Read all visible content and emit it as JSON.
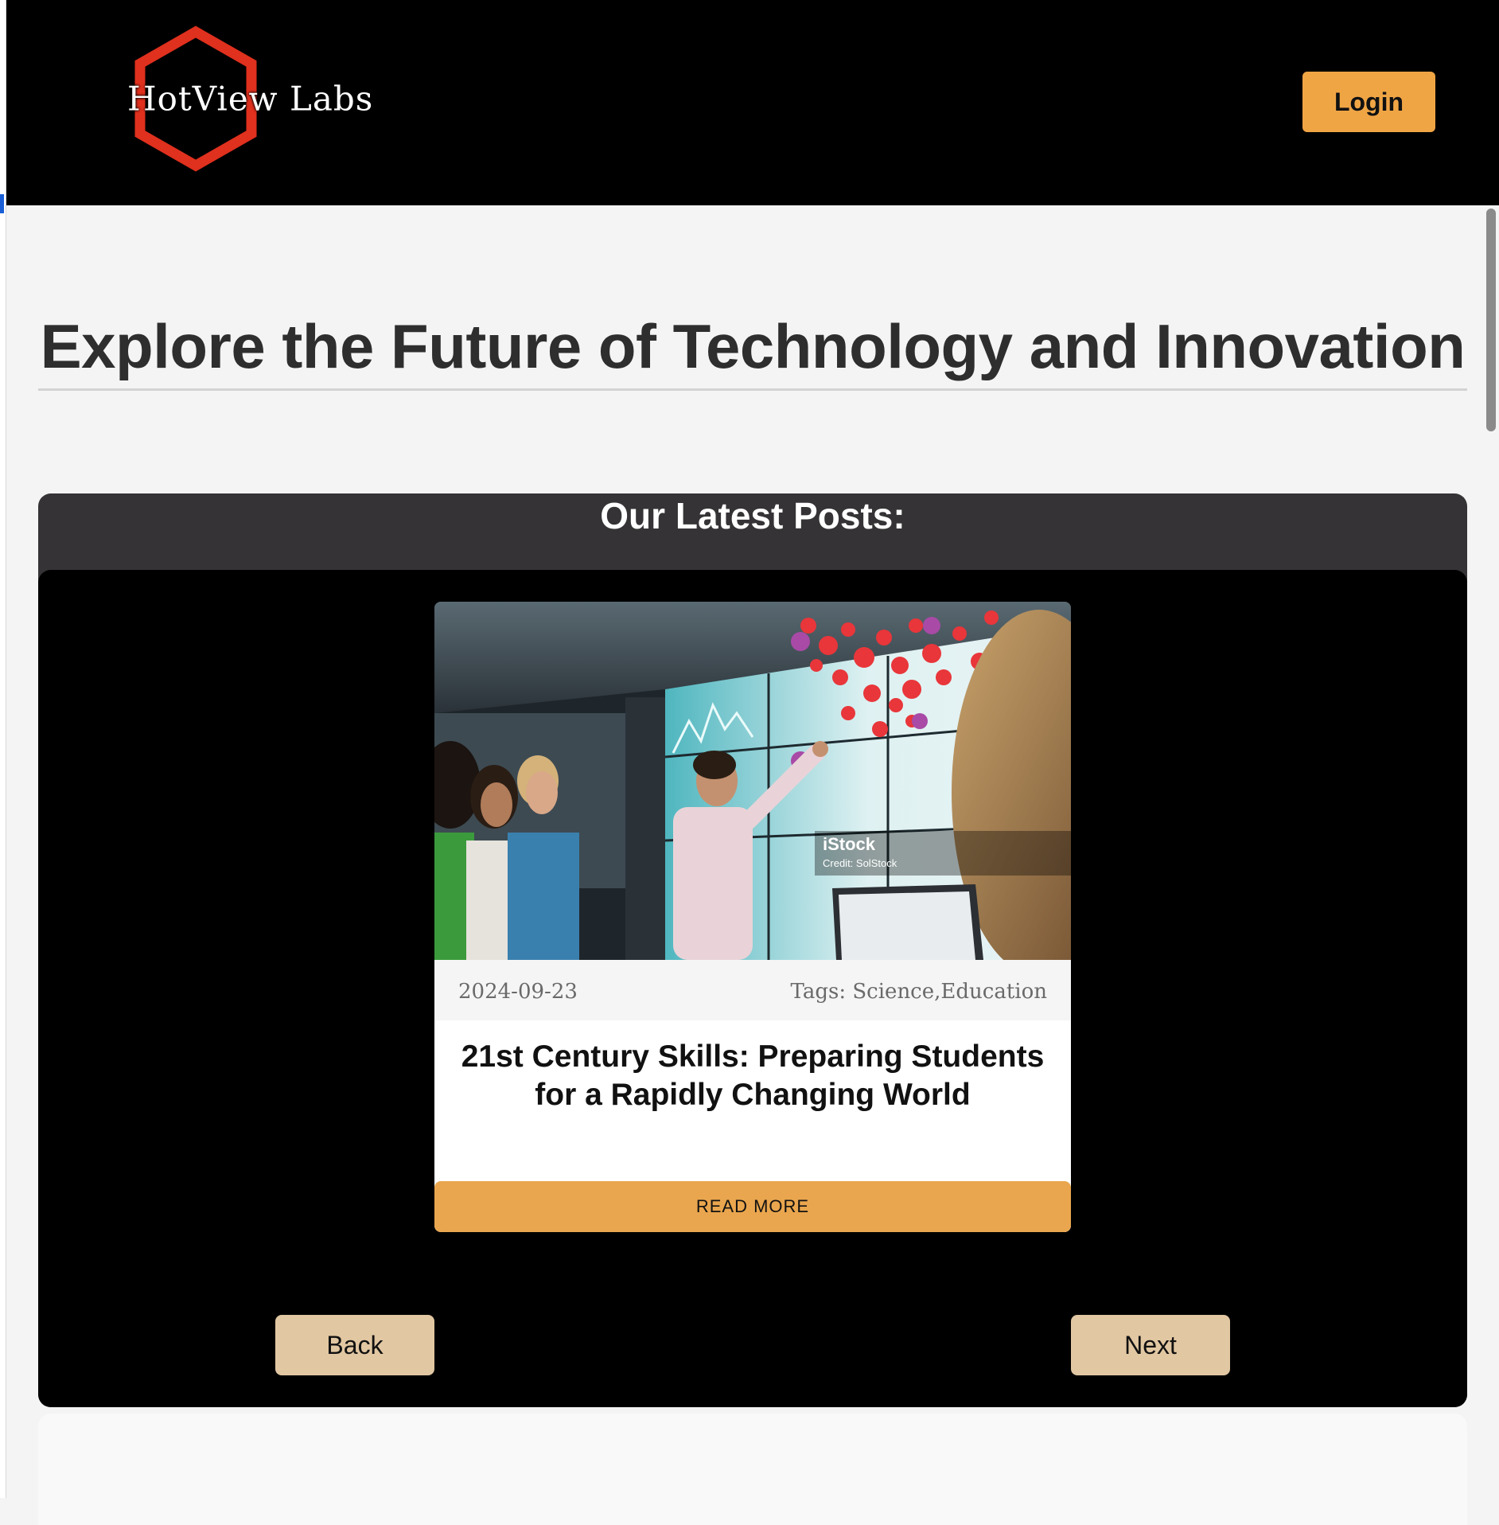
{
  "header": {
    "logo_text": "HotView Labs",
    "login_label": "Login"
  },
  "hero": {
    "title": "Explore the Future of Technology and Innovation"
  },
  "posts": {
    "heading": "Our Latest Posts:",
    "card": {
      "image_watermark": "iStock",
      "image_credit": "Credit: SolStock",
      "date": "2024-09-23",
      "tags": "Tags: Science,Education",
      "title": "21st Century Skills: Preparing Students for a Rapidly Changing World",
      "read_more_label": "READ MORE"
    },
    "back_label": "Back",
    "next_label": "Next"
  },
  "colors": {
    "header_bg": "#000000",
    "accent_orange": "#f0a545",
    "read_more_bg": "#eaa64e",
    "nav_button_bg": "#e1c7a2",
    "section_bg": "#353335",
    "logo_hexagon": "#e0301e"
  },
  "icons": {
    "logo": "hexagon-logo-icon"
  }
}
